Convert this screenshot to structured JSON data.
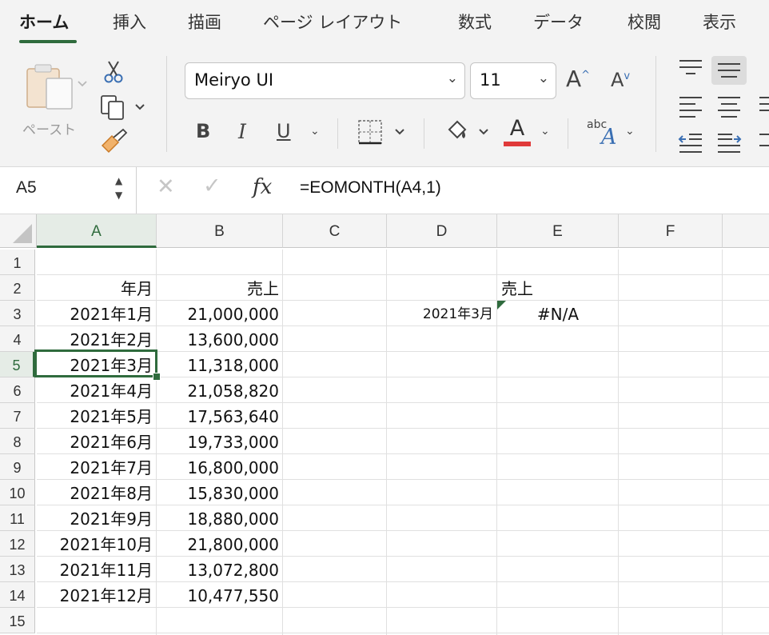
{
  "ribbon": {
    "tabs": [
      "ホーム",
      "挿入",
      "描画",
      "ページ レイアウト",
      "数式",
      "データ",
      "校閲",
      "表示"
    ],
    "paste_label": "ペースト",
    "font_name": "Meiryo UI",
    "font_size": "11",
    "bold": "B",
    "italic": "I",
    "underline": "U",
    "font_color_glyph": "A",
    "font_color": "#e03a3a",
    "wrap_text_glyph": "abc",
    "accent_color": "#2f6b3d"
  },
  "formula_bar": {
    "name_box": "A5",
    "fx": "fx",
    "formula": "=EOMONTH(A4,1)"
  },
  "grid": {
    "columns": [
      "A",
      "B",
      "C",
      "D",
      "E",
      "F"
    ],
    "rows": [
      "1",
      "2",
      "3",
      "4",
      "5",
      "6",
      "7",
      "8",
      "9",
      "10",
      "11",
      "12",
      "13",
      "14",
      "15"
    ],
    "header_a": "年月",
    "header_b": "売上",
    "data": [
      {
        "month": "2021年1月",
        "sales": "21,000,000"
      },
      {
        "month": "2021年2月",
        "sales": "13,600,000"
      },
      {
        "month": "2021年3月",
        "sales": "11,318,000"
      },
      {
        "month": "2021年4月",
        "sales": "21,058,820"
      },
      {
        "month": "2021年5月",
        "sales": "17,563,640"
      },
      {
        "month": "2021年6月",
        "sales": "19,733,000"
      },
      {
        "month": "2021年7月",
        "sales": "16,800,000"
      },
      {
        "month": "2021年8月",
        "sales": "15,830,000"
      },
      {
        "month": "2021年9月",
        "sales": "18,880,000"
      },
      {
        "month": "2021年10月",
        "sales": "21,800,000"
      },
      {
        "month": "2021年11月",
        "sales": "13,072,800"
      },
      {
        "month": "2021年12月",
        "sales": "10,477,550"
      }
    ],
    "lookup_header": "売上",
    "lookup_key": "2021年3月",
    "lookup_result": "#N/A",
    "selected_cell": "A5"
  }
}
